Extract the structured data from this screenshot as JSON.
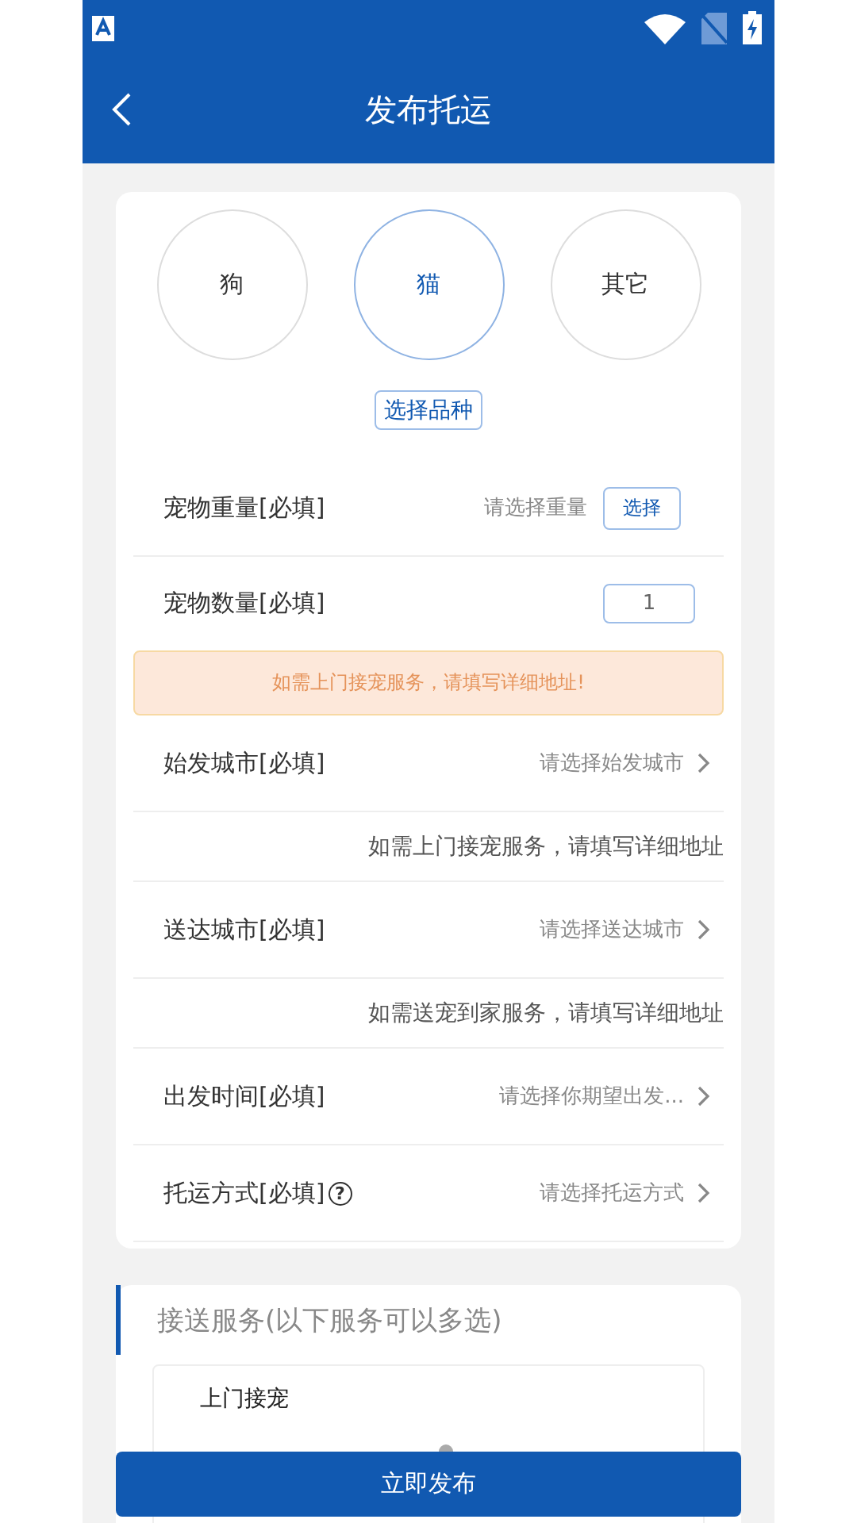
{
  "header": {
    "title": "发布托运"
  },
  "pet_types": [
    {
      "label": "狗",
      "selected": false
    },
    {
      "label": "猫",
      "selected": true
    },
    {
      "label": "其它",
      "selected": false
    }
  ],
  "breed_button": "选择品种",
  "fields": [
    {
      "kind": "weight",
      "label": "宠物重量[必填]",
      "prompt": "请选择重量",
      "button": "选择"
    },
    {
      "kind": "number",
      "label": "宠物数量[必填]",
      "value": "1"
    },
    {
      "kind": "notice",
      "text": "如需上门接宠服务，请填写详细地址!"
    },
    {
      "kind": "select",
      "label": "始发城市[必填]",
      "prompt": "请选择始发城市"
    },
    {
      "kind": "hint",
      "text": "如需上门接宠服务，请填写详细地址"
    },
    {
      "kind": "select",
      "label": "送达城市[必填]",
      "prompt": "请选择送达城市"
    },
    {
      "kind": "hint",
      "text": "如需送宠到家服务，请填写详细地址"
    },
    {
      "kind": "select",
      "label": "出发时间[必填]",
      "prompt": "请选择你期望出发..."
    },
    {
      "kind": "select",
      "label": "托运方式[必填]",
      "help": "?",
      "prompt": "请选择托运方式"
    }
  ],
  "services": {
    "title": "接送服务(以下服务可以多选)",
    "items": [
      {
        "label": "上门接宠"
      }
    ]
  },
  "submit_button": "立即发布"
}
